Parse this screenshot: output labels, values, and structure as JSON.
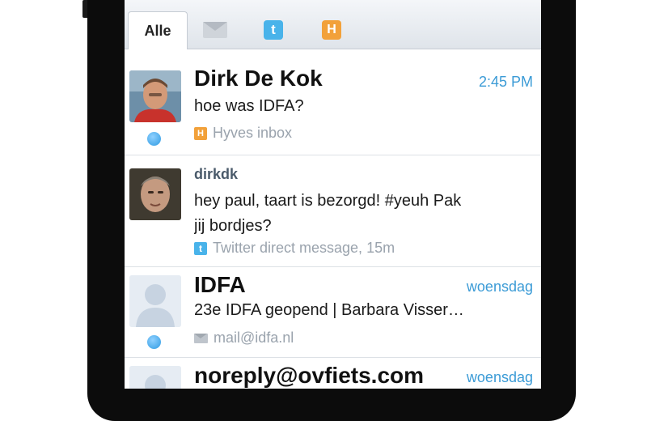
{
  "tabs": {
    "all_label": "Alle",
    "mail_icon": "mail-icon",
    "twitter_icon": "twitter-icon",
    "hyves_icon": "hyves-icon"
  },
  "messages": [
    {
      "sender": "Dirk De Kok",
      "time": "2:45 PM",
      "text": "hoe was IDFA?",
      "source": "Hyves inbox",
      "source_icon": "hyves-icon",
      "unread": true
    },
    {
      "sender": "dirkdk",
      "time": "",
      "text_line1": "hey paul, taart is bezorgd! #yeuh Pak",
      "text_line2": "jij bordjes?",
      "source": "Twitter direct message, 15m",
      "source_icon": "twitter-icon",
      "unread": false
    },
    {
      "sender": "IDFA",
      "time": "woensdag",
      "text": "23e IDFA geopend | Barbara Visser…",
      "source": "mail@idfa.nl",
      "source_icon": "mail-icon",
      "unread": true
    },
    {
      "sender": "noreply@ovfiets.com",
      "time": "woensdag"
    }
  ],
  "colors": {
    "accent": "#3b9bd6",
    "unread_dot": "#2f9be2",
    "twitter": "#49b3ea",
    "hyves": "#f2a13a"
  }
}
